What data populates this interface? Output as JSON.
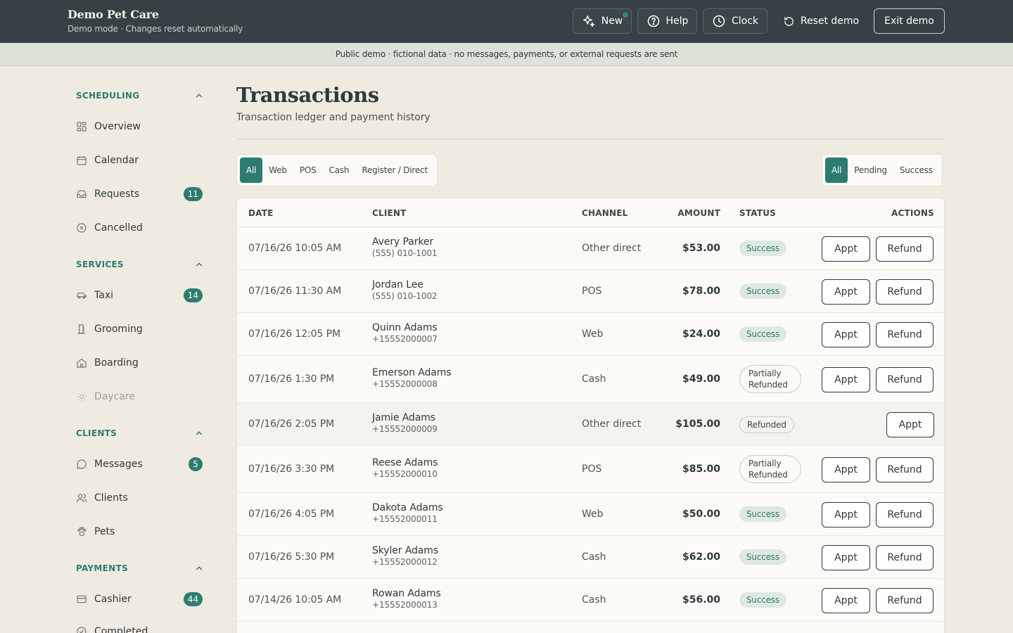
{
  "header": {
    "brand": "Demo Pet Care",
    "subtitle": "Demo mode · Changes reset automatically",
    "new_label": "New",
    "help_label": "Help",
    "clock_label": "Clock",
    "reset_label": "Reset demo",
    "exit_label": "Exit demo"
  },
  "banner": "Public demo · fictional data · no messages, payments, or external requests are sent",
  "sidebar": {
    "scheduling": {
      "title": "SCHEDULING",
      "items": [
        {
          "label": "Overview",
          "icon": "dashboard-icon"
        },
        {
          "label": "Calendar",
          "icon": "calendar-icon"
        },
        {
          "label": "Requests",
          "icon": "inbox-icon",
          "badge": "11"
        },
        {
          "label": "Cancelled",
          "icon": "x-circle-icon"
        }
      ]
    },
    "services": {
      "title": "SERVICES",
      "items": [
        {
          "label": "Taxi",
          "icon": "car-icon",
          "badge": "14"
        },
        {
          "label": "Grooming",
          "icon": "grooming-icon"
        },
        {
          "label": "Boarding",
          "icon": "home-icon"
        },
        {
          "label": "Daycare",
          "icon": "sun-icon"
        }
      ]
    },
    "clients": {
      "title": "CLIENTS",
      "items": [
        {
          "label": "Messages",
          "icon": "message-icon",
          "badge": "5"
        },
        {
          "label": "Clients",
          "icon": "users-icon"
        },
        {
          "label": "Pets",
          "icon": "paw-icon"
        }
      ]
    },
    "payments": {
      "title": "PAYMENTS",
      "items": [
        {
          "label": "Cashier",
          "icon": "credit-card-icon",
          "badge": "44"
        },
        {
          "label": "Completed",
          "icon": "check-circle-icon"
        }
      ]
    }
  },
  "page": {
    "title": "Transactions",
    "subtitle": "Transaction ledger and payment history"
  },
  "channel_filter": [
    "All",
    "Web",
    "POS",
    "Cash",
    "Register / Direct"
  ],
  "status_filter": [
    "All",
    "Pending",
    "Success"
  ],
  "table": {
    "headers": {
      "date": "DATE",
      "client": "CLIENT",
      "channel": "CHANNEL",
      "amount": "AMOUNT",
      "status": "STATUS",
      "actions": "ACTIONS"
    },
    "appt_label": "Appt",
    "refund_label": "Refund",
    "rows": [
      {
        "date": "07/16/26 10:05 AM",
        "name": "Avery Parker",
        "phone": "(555) 010-1001",
        "channel": "Other direct",
        "amount": "$53.00",
        "status": "Success"
      },
      {
        "date": "07/16/26 11:30 AM",
        "name": "Jordan Lee",
        "phone": "(555) 010-1002",
        "channel": "POS",
        "amount": "$78.00",
        "status": "Success"
      },
      {
        "date": "07/16/26 12:05 PM",
        "name": "Quinn Adams",
        "phone": "+15552000007",
        "channel": "Web",
        "amount": "$24.00",
        "status": "Success"
      },
      {
        "date": "07/16/26 1:30 PM",
        "name": "Emerson Adams",
        "phone": "+15552000008",
        "channel": "Cash",
        "amount": "$49.00",
        "status": "Partially Refunded"
      },
      {
        "date": "07/16/26 2:05 PM",
        "name": "Jamie Adams",
        "phone": "+15552000009",
        "channel": "Other direct",
        "amount": "$105.00",
        "status": "Refunded"
      },
      {
        "date": "07/16/26 3:30 PM",
        "name": "Reese Adams",
        "phone": "+15552000010",
        "channel": "POS",
        "amount": "$85.00",
        "status": "Partially Refunded"
      },
      {
        "date": "07/16/26 4:05 PM",
        "name": "Dakota Adams",
        "phone": "+15552000011",
        "channel": "Web",
        "amount": "$50.00",
        "status": "Success"
      },
      {
        "date": "07/16/26 5:30 PM",
        "name": "Skyler Adams",
        "phone": "+15552000012",
        "channel": "Cash",
        "amount": "$62.00",
        "status": "Success"
      },
      {
        "date": "07/14/26 10:05 AM",
        "name": "Rowan Adams",
        "phone": "+15552000013",
        "channel": "Cash",
        "amount": "$56.00",
        "status": "Success"
      }
    ]
  }
}
